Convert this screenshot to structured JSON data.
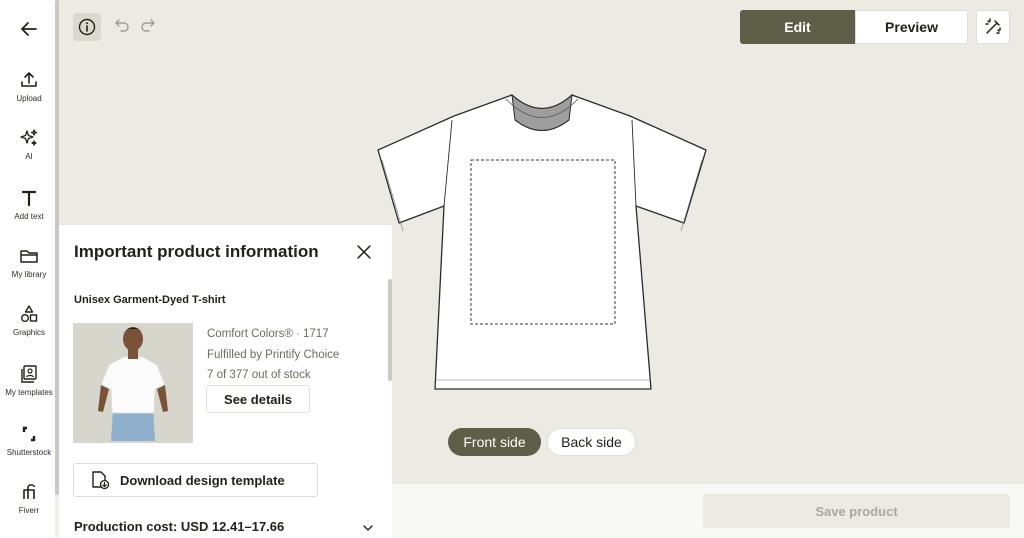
{
  "sidebar": {
    "items": [
      {
        "label": "Upload",
        "icon": "upload-icon"
      },
      {
        "label": "AI",
        "icon": "sparkle-icon"
      },
      {
        "label": "Add text",
        "icon": "text-icon"
      },
      {
        "label": "My library",
        "icon": "folder-icon"
      },
      {
        "label": "Graphics",
        "icon": "shapes-icon"
      },
      {
        "label": "My templates",
        "icon": "templates-icon"
      },
      {
        "label": "Shutterstock",
        "icon": "shutterstock-icon"
      },
      {
        "label": "Fiverr",
        "icon": "fiverr-icon"
      }
    ]
  },
  "toolbar": {
    "edit_label": "Edit",
    "preview_label": "Preview"
  },
  "canvas": {
    "front_label": "Front side",
    "back_label": "Back side"
  },
  "footer": {
    "save_label": "Save product"
  },
  "panel": {
    "title": "Important product information",
    "product_name": "Unisex Garment-Dyed T-shirt",
    "brand": "Comfort Colors® · 1717",
    "fulfilled": "Fulfilled by Printify Choice",
    "stock": "7 of 377 out of stock",
    "details_label": "See details",
    "download_label": "Download design template",
    "cost": "Production cost: USD 12.41–17.66"
  },
  "colors": {
    "accent": "#5f5e48",
    "canvas_bg": "#ebebe4"
  }
}
